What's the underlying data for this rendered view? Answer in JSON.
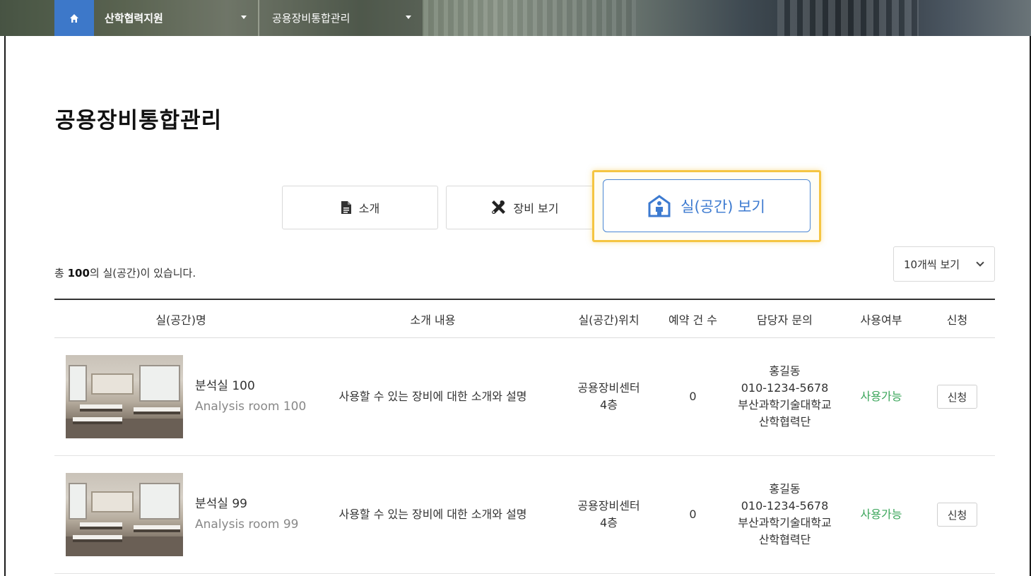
{
  "nav": {
    "home_icon": "home-icon",
    "crumbs": [
      "산학협력지원",
      "공용장비통합관리"
    ]
  },
  "page": {
    "title": "공용장비통합관리"
  },
  "tabs": [
    {
      "label": "소개",
      "icon": "document-icon",
      "active": false
    },
    {
      "label": "장비 보기",
      "icon": "tools-icon",
      "active": false
    },
    {
      "label": "실(공간) 보기",
      "icon": "room-person-icon",
      "active": true
    }
  ],
  "summary": {
    "prefix": "총 ",
    "count": "100",
    "suffix": "의 실(공간)이 있습니다."
  },
  "per_page": {
    "selected": "10개씩 보기"
  },
  "table": {
    "headers": [
      "실(공간)명",
      "소개 내용",
      "실(공간)위치",
      "예약 건 수",
      "담당자 문의",
      "사용여부",
      "신청"
    ],
    "rows": [
      {
        "name_ko": "분석실 100",
        "name_en": "Analysis room 100",
        "desc": "사용할 수 있는 장비에 대한 소개와 설명",
        "loc_1": "공용장비센터",
        "loc_2": "4층",
        "reservations": "0",
        "contact_name": "홍길동",
        "contact_phone": "010-1234-5678",
        "contact_org1": "부산과학기술대학교",
        "contact_org2": "산학협력단",
        "status": "사용가능",
        "apply": "신청"
      },
      {
        "name_ko": "분석실 99",
        "name_en": "Analysis room 99",
        "desc": "사용할 수 있는 장비에 대한 소개와 설명",
        "loc_1": "공용장비센터",
        "loc_2": "4층",
        "reservations": "0",
        "contact_name": "홍길동",
        "contact_phone": "010-1234-5678",
        "contact_org1": "부산과학기술대학교",
        "contact_org2": "산학협력단",
        "status": "사용가능",
        "apply": "신청"
      }
    ]
  },
  "colors": {
    "accent": "#3c7ad0",
    "highlight": "#f5c542",
    "status_ok": "#3aa55a",
    "home_bg": "#3d78c9"
  }
}
